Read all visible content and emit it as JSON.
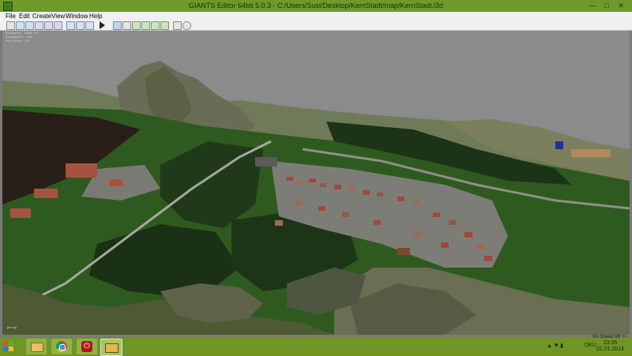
{
  "window": {
    "title": "GIANTS Editor 64bit 5.0.3 - C:/Users/Susi/Desktop/KernStadt/map/KernStadt.i3d"
  },
  "menu": [
    "File",
    "Edit",
    "Create",
    "View",
    "Window",
    "Help"
  ],
  "toolbar_icons": [
    "new-file-icon",
    "open-file-icon",
    "save-icon",
    "save-as-icon",
    "import-icon",
    "export-icon",
    "undo-icon",
    "redo-icon",
    "redo-all-icon",
    "play-icon",
    "select-icon",
    "move-icon",
    "terrain-sculpt-icon",
    "terrain-paint-icon",
    "foliage-paint-icon",
    "decal-icon",
    "settings-icon",
    "search-icon"
  ],
  "viewport": {
    "stats": [
      "Distance: 1843.74",
      "Triangles: 148",
      "Vertices: 171"
    ],
    "corner_label": "persp",
    "speed_label": "No Speed 98 +/-"
  },
  "taskbar": {
    "tray_language": "DEU",
    "clock_time": "23:35",
    "clock_date": "01.01.2014"
  },
  "colors": {
    "title_green": "#6f9a2a",
    "taskbar_green": "#6e9624",
    "grass": "#2e5a1f",
    "forest": "#1f3a18"
  }
}
